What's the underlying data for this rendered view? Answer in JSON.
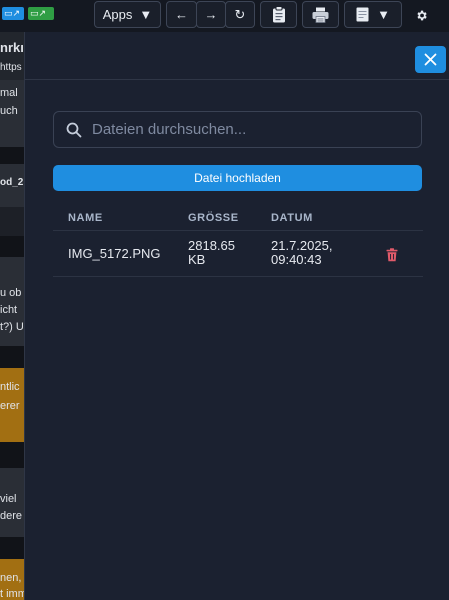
{
  "toolbar": {
    "apps_label": "Apps",
    "apps_caret": "▼",
    "back_arrow": "←",
    "forward_arrow": "→",
    "reload": "↻",
    "edit_caret": "▼",
    "chip_colors": [
      "#1f8ee0",
      "#2f9e44"
    ]
  },
  "background_page": {
    "lines": [
      "nrkı",
      "https",
      "mal",
      "uch",
      "od_2",
      "u ob",
      "icht",
      "t?) U",
      "ntlic",
      "erer",
      "viel",
      "dere",
      "nen, e",
      "t imm"
    ]
  },
  "panel": {
    "search": {
      "placeholder": "Dateien durchsuchen..."
    },
    "upload_button_label": "Datei hochladen",
    "table": {
      "headers": {
        "name": "NAME",
        "size": "GRÖSSE",
        "date": "DATUM"
      },
      "rows": [
        {
          "name": "IMG_5172.PNG",
          "size": "2818.65 KB",
          "date": "21.7.2025, 09:40:43"
        }
      ]
    }
  },
  "colors": {
    "accent": "#1f8ee0",
    "panel_bg": "#1b2130",
    "delete_icon": "#e05a6a",
    "header_text": "#a9b6ca"
  }
}
